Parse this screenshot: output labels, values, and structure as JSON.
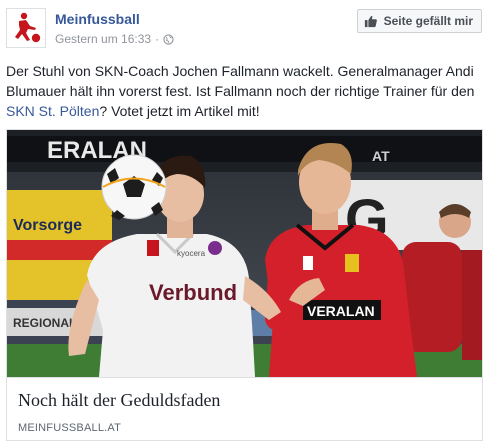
{
  "post": {
    "page_name": "Meinfussball",
    "timestamp": "Gestern um 16:33",
    "separator": "·",
    "privacy_icon": "globe-icon",
    "like_page_label": "Seite gefällt mir",
    "text_before_link": "Der Stuhl von SKN-Coach Jochen Fallmann wackelt. Generalmanager Andi Blumauer hält ihn vorerst fest. Ist Fallmann noch der richtige Trainer für den ",
    "text_link": "SKN St. Pölten",
    "text_after_link": "? Votet jetzt im Artikel mit!"
  },
  "attachment": {
    "title": "Noch hält der Geduldsfaden",
    "domain": "MEINFUSSBALL.AT",
    "photo_texts": {
      "jersey_left_sponsor": "Verbund",
      "jersey_left_small": "kyocera",
      "jersey_right_sponsor": "VERALAN",
      "board_top": "ERALAN",
      "board_top_right": "AT",
      "board_left": "Vorsorge",
      "board_right": "G",
      "board_bottom_left": "REGIONAL"
    }
  },
  "colors": {
    "link": "#365899",
    "text": "#1d2129",
    "meta": "#90949c",
    "home_kit": "#f2f2f2",
    "away_kit": "#d3202a",
    "pitch": "#3f7d35"
  }
}
